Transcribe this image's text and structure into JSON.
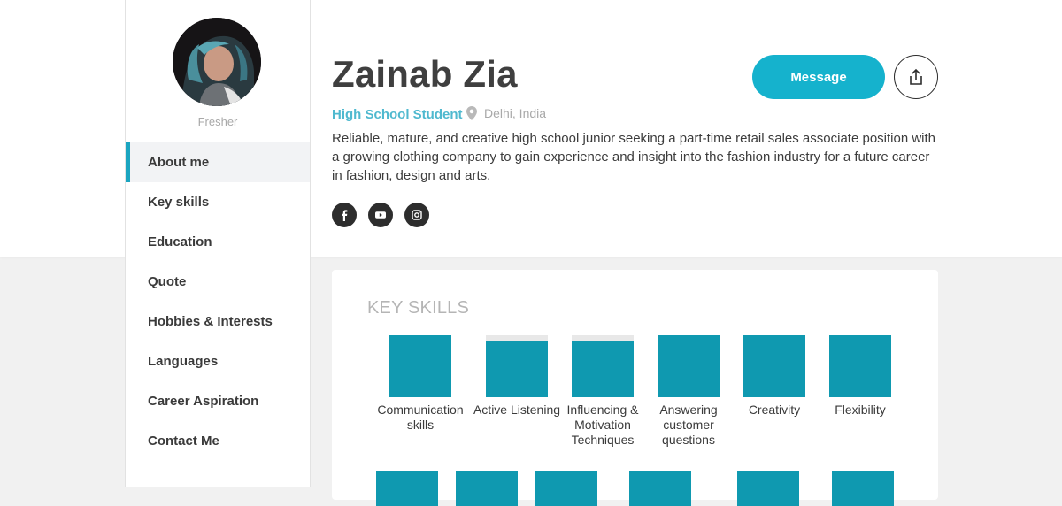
{
  "profile": {
    "name": "Zainab Zia",
    "status": "Fresher",
    "role": "High School Student",
    "location": "Delhi, India",
    "bio": "Reliable, mature, and creative high school junior seeking a part-time retail sales associate position with a growing clothing company to gain experience and insight into the fashion industry for a future career in fashion, design and arts."
  },
  "actions": {
    "message_label": "Message",
    "share_icon": "share-icon"
  },
  "socials": [
    "facebook-icon",
    "youtube-icon",
    "instagram-icon"
  ],
  "nav": {
    "items": [
      {
        "label": "About me",
        "active": true
      },
      {
        "label": "Key skills",
        "active": false
      },
      {
        "label": "Education",
        "active": false
      },
      {
        "label": "Quote",
        "active": false
      },
      {
        "label": "Hobbies & Interests",
        "active": false
      },
      {
        "label": "Languages",
        "active": false
      },
      {
        "label": "Career Aspiration",
        "active": false
      },
      {
        "label": "Contact Me",
        "active": false
      }
    ]
  },
  "key_skills": {
    "title": "KEY SKILLS",
    "items": [
      {
        "label": "Communication skills",
        "level": 1.0
      },
      {
        "label": "Active Listening",
        "level": 0.9
      },
      {
        "label": "Influencing & Motivation Techniques",
        "level": 0.9
      },
      {
        "label": "Answering customer questions",
        "level": 1.0
      },
      {
        "label": "Creativity",
        "level": 1.0
      },
      {
        "label": "Flexibility",
        "level": 1.0
      }
    ]
  },
  "colors": {
    "accent": "#15b2cd",
    "skill_fill": "#0f99b0",
    "role_text": "#4fb9cf",
    "active_nav_border": "#1ba5c0"
  }
}
